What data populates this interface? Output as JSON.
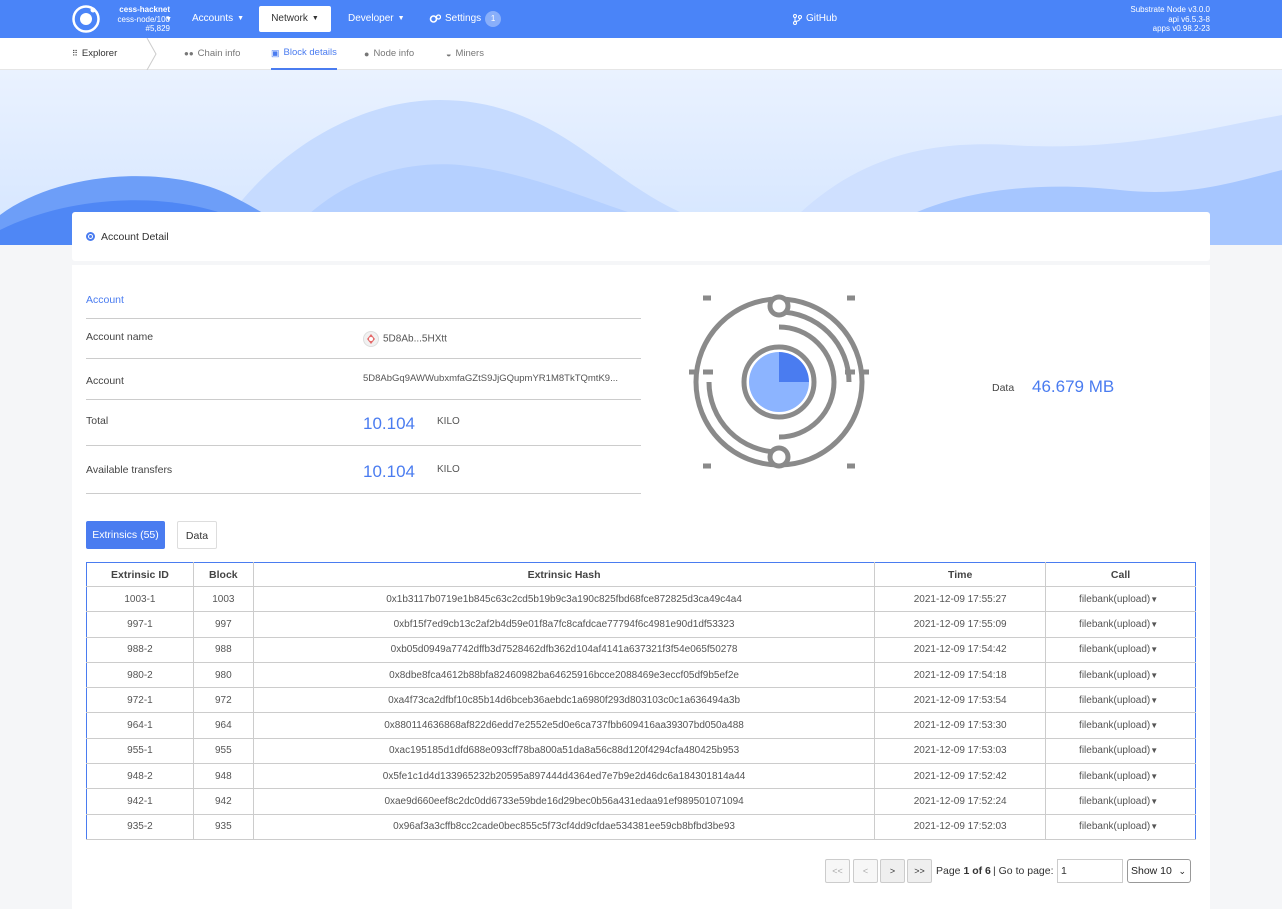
{
  "header": {
    "chain": "cess-hacknet",
    "node": "cess-node/100",
    "block": "#5,829",
    "nav": {
      "accounts": "Accounts",
      "network": "Network",
      "developer": "Developer",
      "settings": "Settings",
      "settings_badge": "1",
      "github": "GitHub"
    },
    "versions": [
      "Substrate Node v3.0.0",
      "api v6.5.3-8",
      "apps v0.98.2-23"
    ]
  },
  "subnav": {
    "explorer": "Explorer",
    "chain_info": "Chain info",
    "block_details": "Block details",
    "node_info": "Node info",
    "miners": "Miners"
  },
  "panel": {
    "title": "Account Detail"
  },
  "account": {
    "section_title": "Account",
    "name_label": "Account name",
    "name_value": "5D8Ab...5HXtt",
    "account_label": "Account",
    "account_value": "5D8AbGq9AWWubxmfaGZtS9JjGQupmYR1M8TkTQmtK9...",
    "total_label": "Total",
    "total_value": "10.104",
    "total_unit": "KILO",
    "avail_label": "Available transfers",
    "avail_value": "10.104",
    "avail_unit": "KILO"
  },
  "data_stat": {
    "label": "Data",
    "value": "46.679 MB"
  },
  "tabs": {
    "extrinsics": "Extrinsics (55)",
    "data": "Data"
  },
  "table": {
    "headers": [
      "Extrinsic ID",
      "Block",
      "Extrinsic Hash",
      "Time",
      "Call"
    ],
    "rows": [
      [
        "1003-1",
        "1003",
        "0x1b3117b0719e1b845c63c2cd5b19b9c3a190c825fbd68fce872825d3ca49c4a4",
        "2021-12-09 17:55:27",
        "filebank(upload)"
      ],
      [
        "997-1",
        "997",
        "0xbf15f7ed9cb13c2af2b4d59e01f8a7fc8cafdcae77794f6c4981e90d1df53323",
        "2021-12-09 17:55:09",
        "filebank(upload)"
      ],
      [
        "988-2",
        "988",
        "0xb05d0949a7742dffb3d7528462dfb362d104af4141a637321f3f54e065f50278",
        "2021-12-09 17:54:42",
        "filebank(upload)"
      ],
      [
        "980-2",
        "980",
        "0x8dbe8fca4612b88bfa82460982ba64625916bcce2088469e3eccf05df9b5ef2e",
        "2021-12-09 17:54:18",
        "filebank(upload)"
      ],
      [
        "972-1",
        "972",
        "0xa4f73ca2dfbf10c85b14d6bceb36aebdc1a6980f293d803103c0c1a636494a3b",
        "2021-12-09 17:53:54",
        "filebank(upload)"
      ],
      [
        "964-1",
        "964",
        "0x880114636868af822d6edd7e2552e5d0e6ca737fbb609416aa39307bd050a488",
        "2021-12-09 17:53:30",
        "filebank(upload)"
      ],
      [
        "955-1",
        "955",
        "0xac195185d1dfd688e093cff78ba800a51da8a56c88d120f4294cfa480425b953",
        "2021-12-09 17:53:03",
        "filebank(upload)"
      ],
      [
        "948-2",
        "948",
        "0x5fe1c1d4d133965232b20595a897444d4364ed7e7b9e2d46dc6a184301814a44",
        "2021-12-09 17:52:42",
        "filebank(upload)"
      ],
      [
        "942-1",
        "942",
        "0xae9d660eef8c2dc0dd6733e59bde16d29bec0b56a431edaa91ef989501071094",
        "2021-12-09 17:52:24",
        "filebank(upload)"
      ],
      [
        "935-2",
        "935",
        "0x96af3a3cffb8cc2cade0bec855c5f73cf4dd9cfdae534381ee59cb8bfbd3be93",
        "2021-12-09 17:52:03",
        "filebank(upload)"
      ]
    ]
  },
  "pagination": {
    "first": "<<",
    "prev": "<",
    "next": ">",
    "last": ">>",
    "page_word": "Page",
    "page_num": "1 of 6",
    "goto": "| Go to page:",
    "goto_value": "1",
    "show": "Show 10"
  },
  "colors": {
    "brand": "#4a84f8",
    "accent": "#4a7cf0"
  }
}
